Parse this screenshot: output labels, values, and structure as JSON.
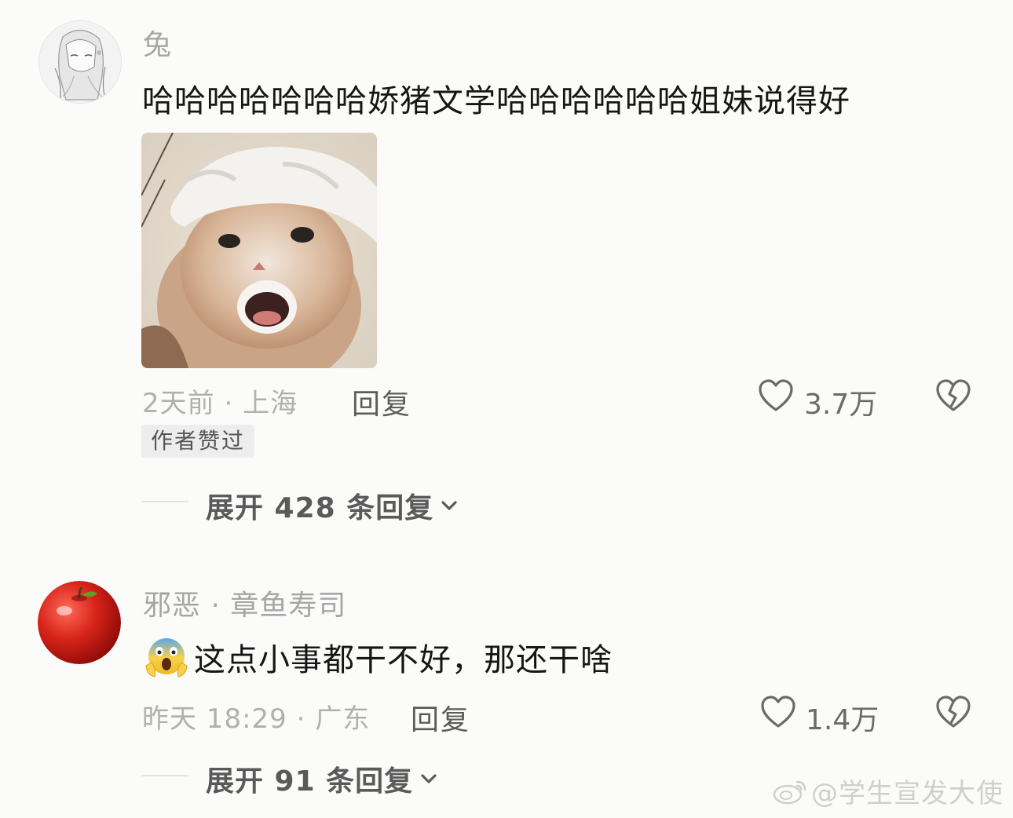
{
  "comments": [
    {
      "username": "兔",
      "text": "哈哈哈哈哈哈哈娇猪文学哈哈哈哈哈哈姐妹说得好",
      "time": "2天前",
      "location": "上海",
      "reply_label": "回复",
      "like_count": "3.7万",
      "badge": "作者赞过",
      "expand_label": "展开 428 条回复"
    },
    {
      "username": "邪恶",
      "username_suffix": "章鱼寿司",
      "text": "这点小事都干不好，那还干啥",
      "time": "昨天 18:29",
      "location": "广东",
      "reply_label": "回复",
      "like_count": "1.4万",
      "expand_label": "展开 91 条回复"
    }
  ],
  "watermark": "@学生宣发大使",
  "colors": {
    "background": "#fbfbf9",
    "meta": "#b0b0b0",
    "text": "#161616"
  }
}
